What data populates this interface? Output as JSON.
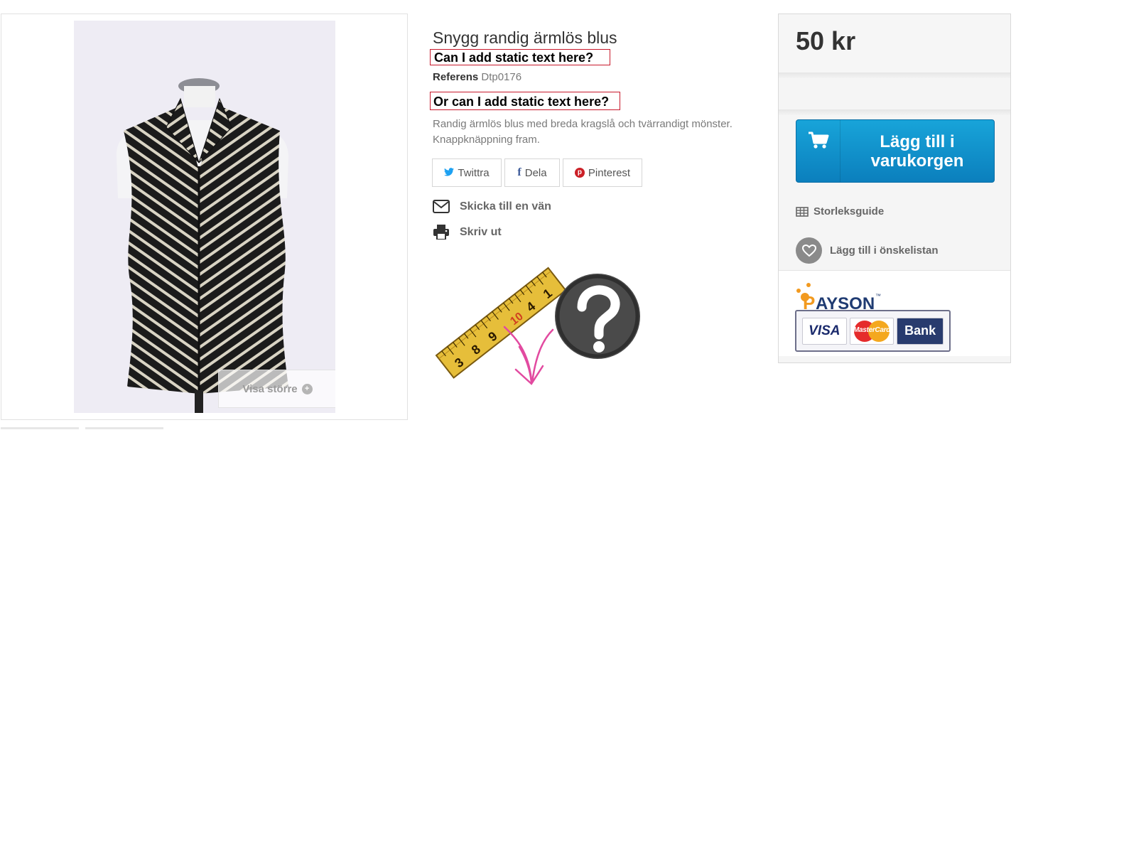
{
  "gallery": {
    "zoom_label": "Visa större",
    "zoom_icon": "zoom-plus-icon"
  },
  "product": {
    "title": "Snygg randig ärmlös blus",
    "static_text_1": "Can I add static text here?",
    "static_text_2": "Or can I add static text here?",
    "reference_label": "Referens",
    "reference_value": "Dtp0176",
    "description": "Randig ärmlös blus med breda kragslå och tvärrandigt mönster. Knappknäppning fram."
  },
  "share": {
    "twitter_label": "Twittra",
    "facebook_label": "Dela",
    "pinterest_label": "Pinterest",
    "twitter_icon": "twitter-icon",
    "facebook_icon": "facebook-icon",
    "pinterest_icon": "pinterest-icon"
  },
  "actions": {
    "send_friend_label": "Skicka till en vän",
    "print_label": "Skriv ut"
  },
  "illustration": {
    "tape_numbers": [
      "3",
      "8",
      "9",
      "10",
      "4",
      "1"
    ]
  },
  "buy_box": {
    "price": "50 kr",
    "add_to_cart_label": "Lägg till i varukorgen",
    "size_guide_label": "Storleksguide",
    "wishlist_label": "Lägg till i önskelistan",
    "accent_color": "#0f8fcb"
  },
  "payment": {
    "provider_letter": "P",
    "provider_rest": "AYSON",
    "provider_tm": "™",
    "cards": [
      "VISA",
      "MasterCard",
      "Bank"
    ]
  }
}
